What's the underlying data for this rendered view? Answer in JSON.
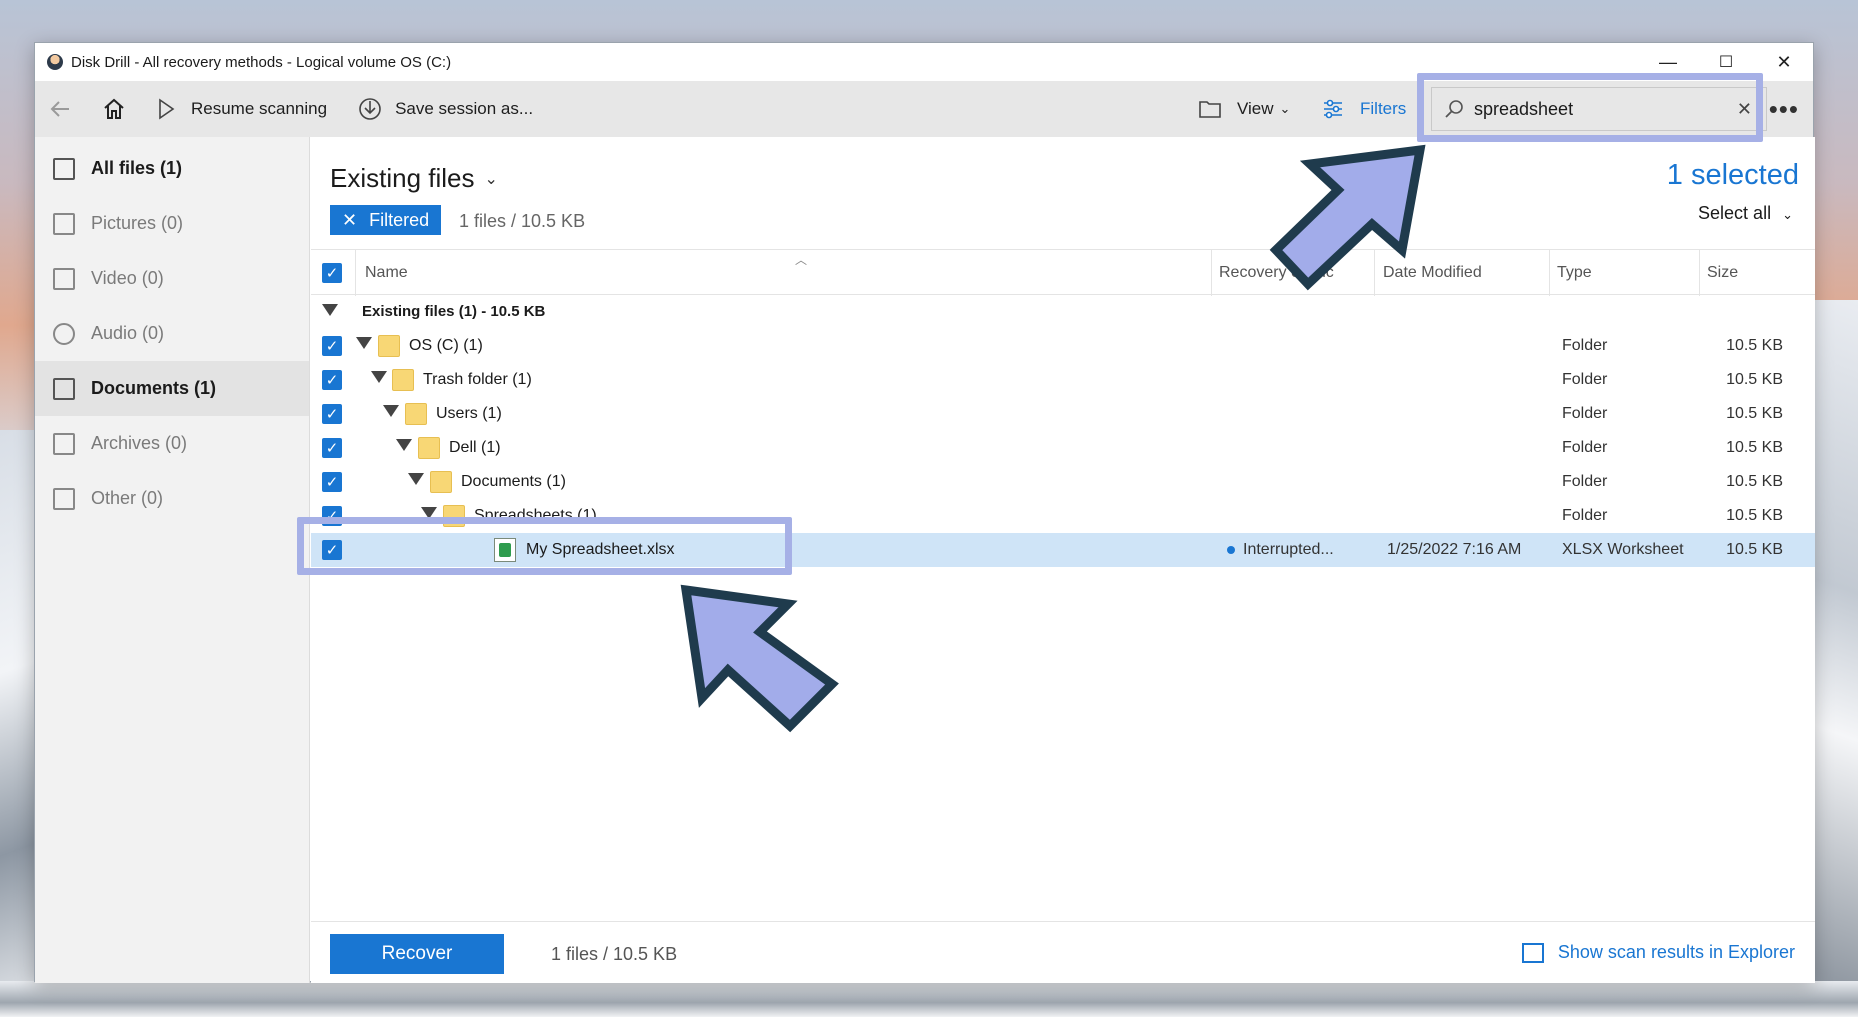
{
  "window": {
    "title": "Disk Drill - All recovery methods - Logical volume OS (C:)",
    "controls": {
      "minimize": "—",
      "maximize": "☐",
      "close": "✕"
    }
  },
  "toolbar": {
    "back_icon": "back-arrow-icon",
    "home_icon": "home-icon",
    "resume_label": "Resume scanning",
    "save_label": "Save session as...",
    "view_label": "View",
    "filters_label": "Filters",
    "search_value": "spreadsheet",
    "more_icon": "more-icon"
  },
  "sidebar": {
    "items": [
      {
        "label": "All files (1)",
        "icon": "all-files-icon"
      },
      {
        "label": "Pictures (0)",
        "icon": "pictures-icon"
      },
      {
        "label": "Video (0)",
        "icon": "video-icon"
      },
      {
        "label": "Audio (0)",
        "icon": "audio-icon"
      },
      {
        "label": "Documents (1)",
        "icon": "documents-icon"
      },
      {
        "label": "Archives (0)",
        "icon": "archives-icon"
      },
      {
        "label": "Other (0)",
        "icon": "other-icon"
      }
    ]
  },
  "main": {
    "heading": "Existing files",
    "filter_chip": "Filtered",
    "summary": "1 files / 10.5 KB",
    "selected": "1 selected",
    "select_all": "Select all"
  },
  "table": {
    "columns": {
      "name": "Name",
      "recovery": "Recovery chanc",
      "date": "Date Modified",
      "type": "Type",
      "size": "Size"
    },
    "group_label": "Existing files (1) - 10.5 KB",
    "rows": [
      {
        "name": "OS (C) (1)",
        "type": "Folder",
        "size": "10.5 KB"
      },
      {
        "name": "Trash folder (1)",
        "type": "Folder",
        "size": "10.5 KB"
      },
      {
        "name": "Users (1)",
        "type": "Folder",
        "size": "10.5 KB"
      },
      {
        "name": "Dell (1)",
        "type": "Folder",
        "size": "10.5 KB"
      },
      {
        "name": "Documents (1)",
        "type": "Folder",
        "size": "10.5 KB"
      },
      {
        "name": "Spreadsheets (1)",
        "type": "Folder",
        "size": "10.5 KB"
      },
      {
        "name": "My Spreadsheet.xlsx",
        "recovery": "Interrupted...",
        "date": "1/25/2022 7:16 AM",
        "type": "XLSX Worksheet",
        "size": "10.5 KB"
      }
    ]
  },
  "bottom": {
    "recover_label": "Recover",
    "summary": "1 files / 10.5 KB",
    "explorer_link": "Show scan results in Explorer"
  },
  "colors": {
    "accent": "#1976d2",
    "highlight": "#a6b0e6",
    "arrow_fill": "#a2acea",
    "arrow_stroke": "#1f3b4d",
    "selected_row": "#cfe4f7"
  }
}
